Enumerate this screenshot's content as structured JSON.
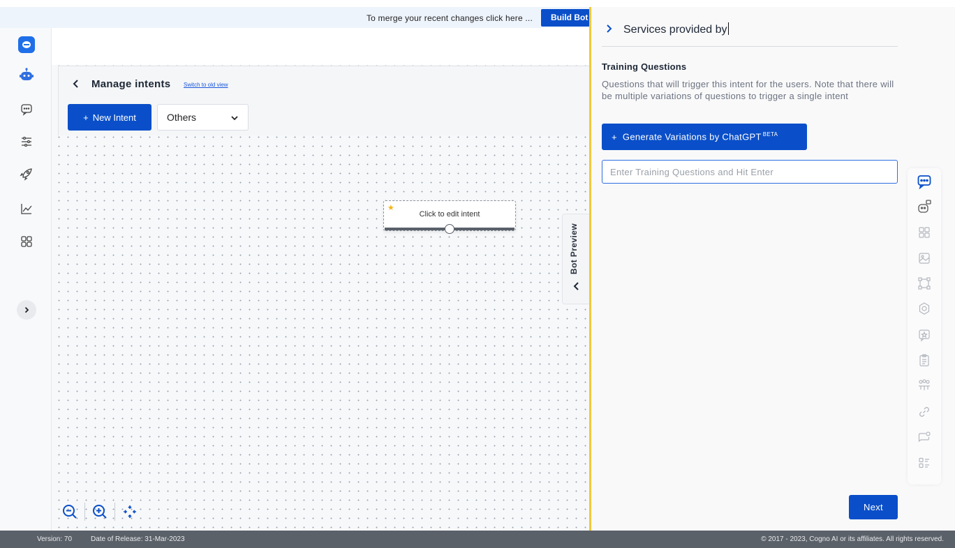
{
  "merge_bar": {
    "message": "To merge your recent changes click here ...",
    "build_label": "Build Bot"
  },
  "left_rail": {
    "icons": [
      "bot-icon",
      "chat-icon",
      "sliders-icon",
      "rocket-icon",
      "analytics-icon",
      "apps-icon",
      "chevron-right-icon"
    ]
  },
  "header": {
    "title": "Manage intents",
    "switch_link": "Switch to old view",
    "new_intent_label": "New Intent",
    "category_selected": "Others"
  },
  "canvas": {
    "node_label": "Click to edit intent",
    "bot_preview_label": "Bot Preview"
  },
  "panel": {
    "intent_name": "Services provided by",
    "training_title": "Training Questions",
    "training_desc": "Questions that will trigger this intent for the users. Note that there will be multiple variations of questions to trigger a single intent",
    "generate_label": "Generate Variations by ChatGPT",
    "generate_badge": "BETA",
    "input_placeholder": "Enter Training Questions and Hit Enter",
    "next_label": "Next"
  },
  "tool_rail": {
    "icons": [
      "message-icon",
      "bot-card-icon",
      "grid-icon",
      "image-icon",
      "crop-icon",
      "settings-icon",
      "feedback-icon",
      "clipboard-icon",
      "team-icon",
      "link-icon",
      "notification-icon",
      "list-icon"
    ]
  },
  "footer": {
    "version": "Version: 70",
    "release": "Date of Release: 31-Mar-2023",
    "copyright": "© 2017 - 2023, Cogno AI or its affiliates. All rights reserved."
  },
  "colors": {
    "primary": "#0a4fc9",
    "panel_divider": "#f0c93a",
    "footer_bg": "#5b6169"
  }
}
